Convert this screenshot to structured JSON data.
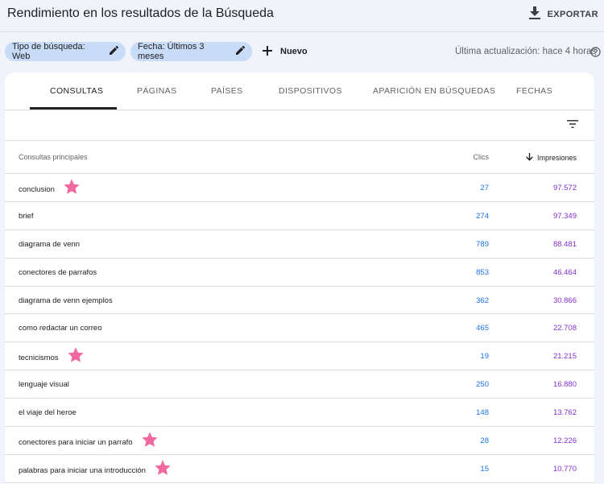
{
  "header": {
    "title": "Rendimiento en los resultados de la Búsqueda",
    "export_label": "EXPORTAR"
  },
  "filters": {
    "search_type": "Tipo de búsqueda: Web",
    "date": "Fecha: Últimos 3 meses",
    "new_label": "Nuevo",
    "last_updated": "Última actualización: hace 4 horas"
  },
  "tabs": [
    {
      "label": "CONSULTAS",
      "active": true
    },
    {
      "label": "PÁGINAS",
      "active": false
    },
    {
      "label": "PAÍSES",
      "active": false
    },
    {
      "label": "DISPOSITIVOS",
      "active": false
    },
    {
      "label": "APARICIÓN EN BÚSQUEDAS",
      "active": false
    },
    {
      "label": "FECHAS",
      "active": false
    }
  ],
  "table": {
    "headers": {
      "query": "Consultas principales",
      "clicks": "Clics",
      "impressions": "Impresiones"
    },
    "sort": {
      "column": "impressions",
      "direction": "desc"
    },
    "rows": [
      {
        "query": "conclusion",
        "clicks": "27",
        "impressions": "97.572",
        "starred": true
      },
      {
        "query": "brief",
        "clicks": "274",
        "impressions": "97.349",
        "starred": false
      },
      {
        "query": "diagrama de venn",
        "clicks": "789",
        "impressions": "88.481",
        "starred": false
      },
      {
        "query": "conectores de parrafos",
        "clicks": "853",
        "impressions": "46.464",
        "starred": false
      },
      {
        "query": "diagrama de venn ejemplos",
        "clicks": "362",
        "impressions": "30.866",
        "starred": false
      },
      {
        "query": "como redactar un correo",
        "clicks": "465",
        "impressions": "22.708",
        "starred": false
      },
      {
        "query": "tecnicismos",
        "clicks": "19",
        "impressions": "21.215",
        "starred": true
      },
      {
        "query": "lenguaje visual",
        "clicks": "250",
        "impressions": "16.880",
        "starred": false
      },
      {
        "query": "el viaje del heroe",
        "clicks": "148",
        "impressions": "13.762",
        "starred": false
      },
      {
        "query": "conectores para iniciar un parrafo",
        "clicks": "28",
        "impressions": "12.226",
        "starred": true
      },
      {
        "query": "palabras para iniciar una introducción",
        "clicks": "15",
        "impressions": "10.770",
        "starred": true
      }
    ]
  },
  "colors": {
    "clicks": "#1a73e8",
    "impressions": "#8430ce",
    "chip_bg": "#c8dcf7",
    "star": "#f06a9f"
  },
  "icons": {
    "export": "download-icon",
    "edit": "pencil-icon",
    "new": "plus-icon",
    "help": "help-icon",
    "filter": "filter-icon",
    "sort": "arrow-down-icon",
    "star": "star-icon"
  }
}
